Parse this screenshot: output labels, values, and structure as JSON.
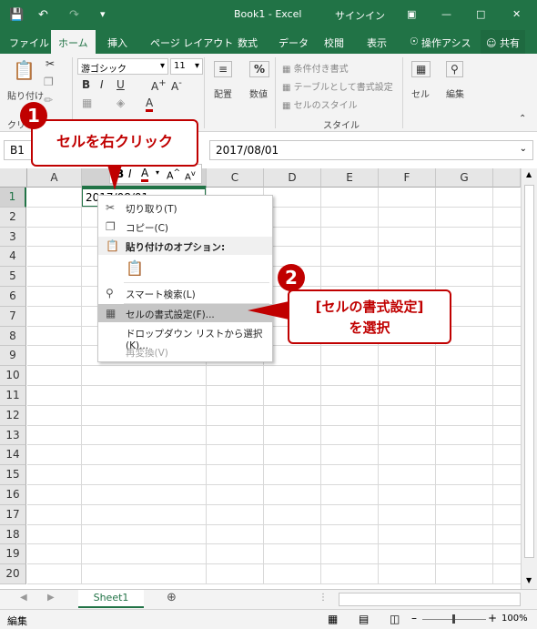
{
  "window": {
    "title": "Book1 - Excel",
    "signin": "サインイン"
  },
  "ribbon_tabs": [
    "ファイル",
    "ホーム",
    "挿入",
    "ページ レイアウト",
    "数式",
    "データ",
    "校閲",
    "表示",
    "操作アシス",
    "共有"
  ],
  "ribbon": {
    "paste_label": "貼り付け",
    "clipboard_label": "クリ",
    "font_name": "游ゴシック",
    "font_size": "11",
    "alignment_label": "配置",
    "number_label": "数値",
    "number_icon": "%",
    "conditional_formatting": "条件付き書式",
    "format_as_table": "テーブルとして書式設定",
    "cell_styles": "セルのスタイル",
    "styles_group_label": "スタイル",
    "cells_label": "セル",
    "editing_label": "編集"
  },
  "formula_bar": {
    "name_box": "B1",
    "value": "2017/08/01"
  },
  "columns": [
    "A",
    "B",
    "C",
    "D",
    "E",
    "F",
    "G"
  ],
  "rows": [
    "1",
    "2",
    "3",
    "4",
    "5",
    "6",
    "7",
    "8",
    "9",
    "10",
    "11",
    "12",
    "13",
    "14",
    "15",
    "16",
    "17",
    "18",
    "19",
    "20"
  ],
  "cell_b1": "2017/08/01",
  "context_menu": {
    "items": [
      {
        "label": "切り取り(T)"
      },
      {
        "label": "コピー(C)"
      },
      {
        "label": "貼り付けのオプション:"
      },
      {
        "label": "スマート検索(L)"
      },
      {
        "label": "セルの書式設定(F)..."
      },
      {
        "label": "ドロップダウン リストから選択(K)..."
      },
      {
        "label": "再変換(V)"
      }
    ]
  },
  "sheet_tab": "Sheet1",
  "status": {
    "mode": "編集",
    "zoom": "100%"
  },
  "annotations": {
    "step1_number": "1",
    "step1_text": "セルを右クリック",
    "step2_number": "2",
    "step2_line1": "[セルの書式設定]",
    "step2_line2": "を選択"
  },
  "colors": {
    "excel_green": "#217346",
    "callout_red": "#c00000"
  }
}
